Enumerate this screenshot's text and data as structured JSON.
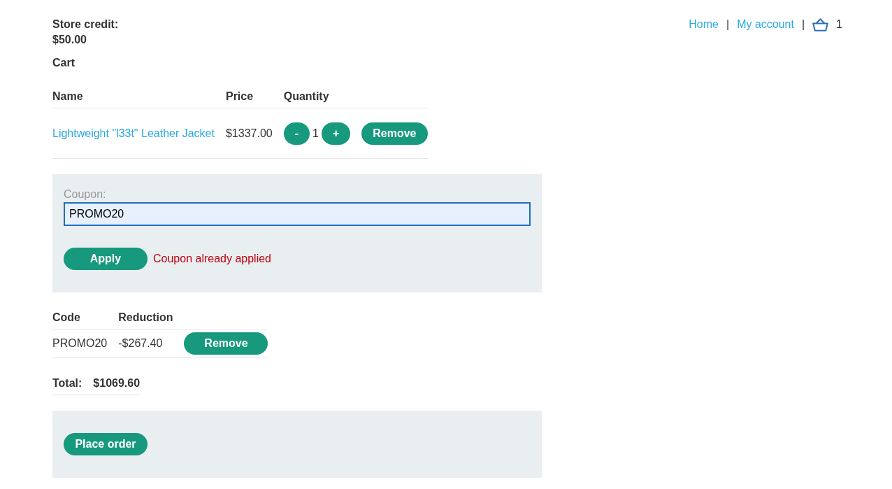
{
  "header": {
    "store_credit": {
      "label": "Store credit:",
      "amount": "$50.00"
    },
    "nav": [
      {
        "kind": "link",
        "label": "Home"
      },
      {
        "kind": "separator",
        "label": "|"
      },
      {
        "kind": "link",
        "label": "My account"
      },
      {
        "kind": "separator",
        "label": "|"
      },
      {
        "kind": "cart",
        "count": "1"
      }
    ]
  },
  "cart": {
    "title": "Cart",
    "columns": [
      "Name",
      "Price",
      "Quantity"
    ],
    "rows": [
      {
        "name": "Lightweight \"l33t\" Leather Jacket",
        "price": "$1337.00",
        "decrease": "-",
        "quantity": "1",
        "increase": "+",
        "remove": "Remove"
      }
    ]
  },
  "coupon": {
    "label": "Coupon:",
    "value": "PROMO20",
    "focused": true,
    "apply": "Apply",
    "message": "Coupon already applied"
  },
  "discounts": {
    "columns": [
      "Code",
      "Reduction"
    ],
    "rows": [
      {
        "code": "PROMO20",
        "reduction": "-$267.40",
        "remove": "Remove"
      }
    ]
  },
  "total": {
    "label": "Total:",
    "amount": "$1069.60"
  },
  "place_order": {
    "label": "Place order"
  }
}
